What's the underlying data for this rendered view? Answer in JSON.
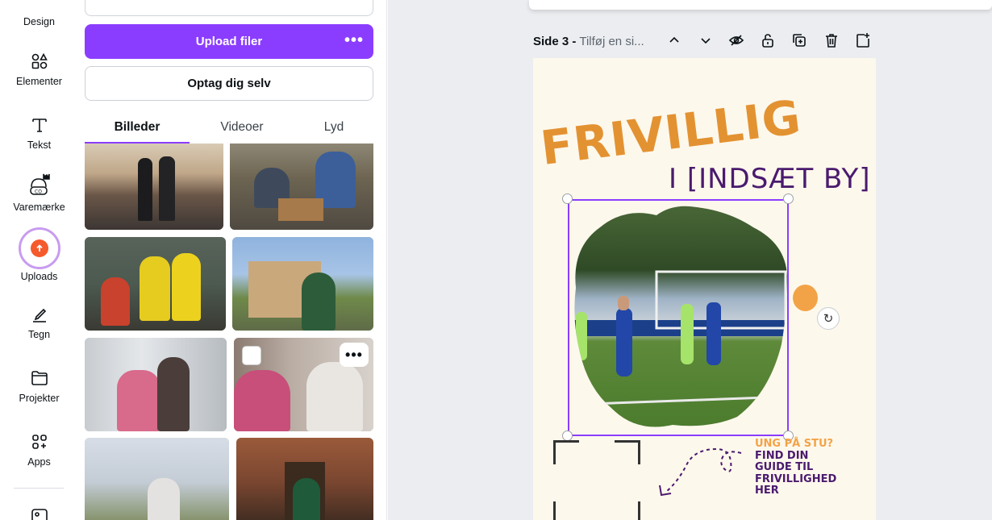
{
  "rail": {
    "items": [
      {
        "label": "Design",
        "icon": "design-icon"
      },
      {
        "label": "Elementer",
        "icon": "shapes-icon"
      },
      {
        "label": "Tekst",
        "icon": "text-icon"
      },
      {
        "label": "Varemærke",
        "icon": "brand-crown-icon"
      },
      {
        "label": "Uploads",
        "icon": "cloud-upload-icon",
        "active": true
      },
      {
        "label": "Tegn",
        "icon": "draw-pen-icon"
      },
      {
        "label": "Projekter",
        "icon": "folder-icon"
      },
      {
        "label": "Apps",
        "icon": "apps-grid-icon"
      }
    ]
  },
  "panel": {
    "upload_label": "Upload filer",
    "upload_more": "•••",
    "record_label": "Optag dig selv",
    "tabs": [
      {
        "label": "Billeder",
        "active": true
      },
      {
        "label": "Videoer"
      },
      {
        "label": "Lyd"
      }
    ],
    "thumb_more": "•••"
  },
  "canvas": {
    "page_label": "Side 3 -",
    "page_title": "Tilføj en si..."
  },
  "poster": {
    "headline": "FRIVILLIG",
    "subheadline": "I [INDSÆT BY]",
    "cta_line1": "UNG PÅ STU?",
    "cta_line2": "FIND DIN",
    "cta_line3": "GUIDE TIL",
    "cta_line4": "FRIVILLIGHED",
    "cta_line5": "HER",
    "rotate_icon": "↻"
  },
  "colors": {
    "accent": "#8b3dff",
    "upload_orange": "#f55a2c",
    "headline_orange": "#e39232",
    "purple_text": "#4a1a6e",
    "poster_bg": "#fdf8ec"
  }
}
